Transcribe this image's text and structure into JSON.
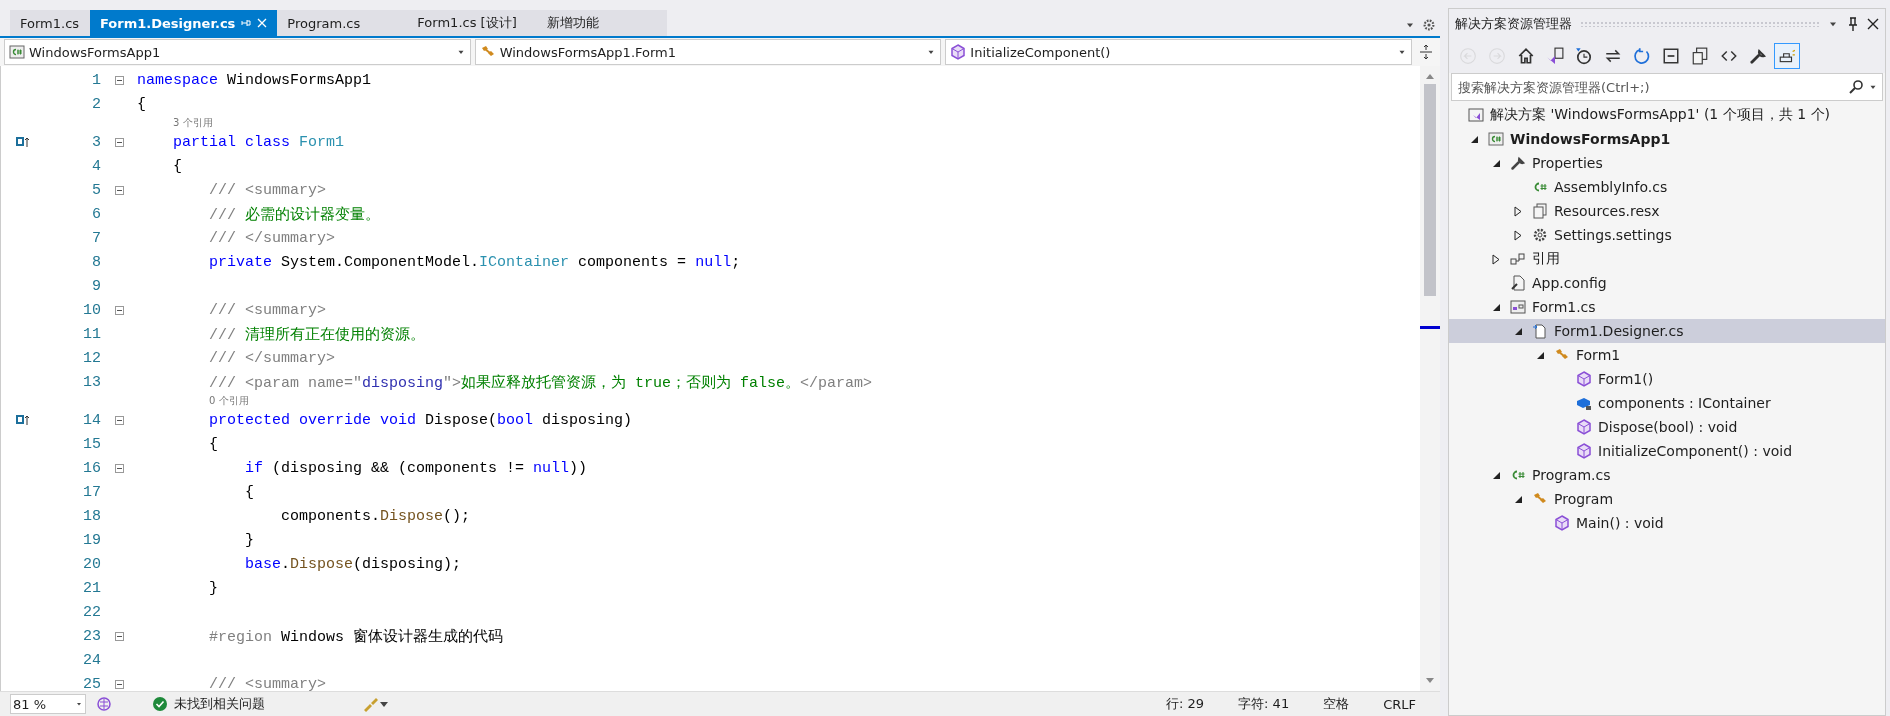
{
  "editor": {
    "tabs": [
      {
        "label": "Form1.cs",
        "selected": false
      },
      {
        "label": "Form1.Designer.cs",
        "selected": true
      },
      {
        "label": "Program.cs",
        "selected": false
      },
      {
        "label": "Form1.cs [设计]",
        "selected": false
      },
      {
        "label": "新增功能",
        "selected": false
      }
    ],
    "nav_bar": [
      {
        "kind": "project",
        "text": "WindowsFormsApp1"
      },
      {
        "kind": "class",
        "text": "WindowsFormsApp1.Form1"
      },
      {
        "kind": "method",
        "text": "InitializeComponent()"
      }
    ],
    "lines": [
      {
        "number": "1",
        "fold_marker": true,
        "margin_glyph": false,
        "tokens": [
          {
            "kind": "keyword",
            "text": "namespace"
          },
          {
            "kind": "plain",
            "text": " WindowsFormsApp1"
          }
        ]
      },
      {
        "number": "2",
        "fold_marker": false,
        "margin_glyph": false,
        "tokens": [
          {
            "kind": "plain",
            "text": "{"
          }
        ]
      },
      {
        "number": "3",
        "fold_marker": true,
        "margin_glyph": true,
        "codelens": "3 个引用",
        "tokens": [
          {
            "kind": "keyword",
            "text": "    partial class "
          },
          {
            "kind": "type",
            "text": "Form1"
          }
        ]
      },
      {
        "number": "4",
        "fold_marker": false,
        "margin_glyph": false,
        "tokens": [
          {
            "kind": "plain",
            "text": "    {"
          }
        ]
      },
      {
        "number": "5",
        "fold_marker": true,
        "margin_glyph": false,
        "tokens": [
          {
            "kind": "doc",
            "text": "        /// <summary>"
          }
        ]
      },
      {
        "number": "6",
        "fold_marker": false,
        "margin_glyph": false,
        "tokens": [
          {
            "kind": "doc",
            "text": "        ///"
          },
          {
            "kind": "comment",
            "text": " 必需的设计器变量。"
          }
        ]
      },
      {
        "number": "7",
        "fold_marker": false,
        "margin_glyph": false,
        "tokens": [
          {
            "kind": "doc",
            "text": "        /// </summary>"
          }
        ]
      },
      {
        "number": "8",
        "fold_marker": false,
        "margin_glyph": false,
        "tokens": [
          {
            "kind": "keyword",
            "text": "        private"
          },
          {
            "kind": "plain",
            "text": " System.ComponentModel."
          },
          {
            "kind": "type",
            "text": "IContainer"
          },
          {
            "kind": "plain",
            "text": " components = "
          },
          {
            "kind": "keyword",
            "text": "null"
          },
          {
            "kind": "plain",
            "text": ";"
          }
        ]
      },
      {
        "number": "9",
        "fold_marker": false,
        "margin_glyph": false
      },
      {
        "number": "10",
        "fold_marker": true,
        "margin_glyph": false,
        "tokens": [
          {
            "kind": "doc",
            "text": "        /// <summary>"
          }
        ]
      },
      {
        "number": "11",
        "fold_marker": false,
        "margin_glyph": false,
        "tokens": [
          {
            "kind": "doc",
            "text": "        ///"
          },
          {
            "kind": "comment",
            "text": " 清理所有正在使用的资源。"
          }
        ]
      },
      {
        "number": "12",
        "fold_marker": false,
        "margin_glyph": false,
        "tokens": [
          {
            "kind": "doc",
            "text": "        /// </summary>"
          }
        ]
      },
      {
        "number": "13",
        "fold_marker": false,
        "margin_glyph": false,
        "tokens": [
          {
            "kind": "doc",
            "text": "        /// <param name=\""
          },
          {
            "kind": "attr",
            "text": "disposing"
          },
          {
            "kind": "doc",
            "text": "\">"
          },
          {
            "kind": "comment",
            "text": "如果应释放托管资源，为 true；否则为 false。"
          },
          {
            "kind": "doc",
            "text": "</param>"
          }
        ]
      },
      {
        "number": "14",
        "fold_marker": true,
        "margin_glyph": true,
        "codelens": "0 个引用",
        "tokens": [
          {
            "kind": "keyword",
            "text": "        protected override void"
          },
          {
            "kind": "plain",
            "text": " Dispose("
          },
          {
            "kind": "keyword",
            "text": "bool"
          },
          {
            "kind": "plain",
            "text": " disposing)"
          }
        ]
      },
      {
        "number": "15",
        "fold_marker": false,
        "margin_glyph": false,
        "tokens": [
          {
            "kind": "plain",
            "text": "        {"
          }
        ]
      },
      {
        "number": "16",
        "fold_marker": true,
        "margin_glyph": false,
        "tokens": [
          {
            "kind": "keyword",
            "text": "            if"
          },
          {
            "kind": "plain",
            "text": " (disposing && (components != "
          },
          {
            "kind": "keyword",
            "text": "null"
          },
          {
            "kind": "plain",
            "text": "))"
          }
        ]
      },
      {
        "number": "17",
        "fold_marker": false,
        "margin_glyph": false,
        "tokens": [
          {
            "kind": "plain",
            "text": "            {"
          }
        ]
      },
      {
        "number": "18",
        "fold_marker": false,
        "margin_glyph": false,
        "tokens": [
          {
            "kind": "plain",
            "text": "                components."
          },
          {
            "kind": "method",
            "text": "Dispose"
          },
          {
            "kind": "plain",
            "text": "();"
          }
        ]
      },
      {
        "number": "19",
        "fold_marker": false,
        "margin_glyph": false,
        "tokens": [
          {
            "kind": "plain",
            "text": "            }"
          }
        ]
      },
      {
        "number": "20",
        "fold_marker": false,
        "margin_glyph": false,
        "tokens": [
          {
            "kind": "keyword",
            "text": "            base"
          },
          {
            "kind": "plain",
            "text": "."
          },
          {
            "kind": "method",
            "text": "Dispose"
          },
          {
            "kind": "plain",
            "text": "(disposing);"
          }
        ]
      },
      {
        "number": "21",
        "fold_marker": false,
        "margin_glyph": false,
        "tokens": [
          {
            "kind": "plain",
            "text": "        }"
          }
        ]
      },
      {
        "number": "22",
        "fold_marker": false,
        "margin_glyph": false
      },
      {
        "number": "23",
        "fold_marker": true,
        "margin_glyph": false,
        "tokens": [
          {
            "kind": "doc",
            "text": "        #region"
          },
          {
            "kind": "plain",
            "text": " Windows 窗体设计器生成的代码"
          }
        ]
      },
      {
        "number": "24",
        "fold_marker": false,
        "margin_glyph": false
      },
      {
        "number": "25",
        "fold_marker": true,
        "margin_glyph": false,
        "tokens": [
          {
            "kind": "doc",
            "text": "        /// <summary>"
          }
        ]
      }
    ],
    "status_bar": {
      "zoom": "81 %",
      "issues": "未找到相关问题",
      "right": [
        "行: 29",
        "字符: 41",
        "空格",
        "CRLF"
      ]
    }
  },
  "solution_explorer": {
    "title": "解决方案资源管理器",
    "toolbar": [
      {
        "kind": "back",
        "disabled": true,
        "on": false
      },
      {
        "kind": "forward",
        "disabled": true,
        "on": false
      },
      {
        "kind": "home",
        "disabled": false,
        "on": false
      },
      {
        "kind": "switch",
        "disabled": false,
        "on": false
      },
      {
        "kind": "history",
        "disabled": false,
        "on": false
      },
      {
        "kind": "sync",
        "disabled": false,
        "on": false
      },
      {
        "kind": "refresh",
        "disabled": false,
        "on": false
      },
      {
        "kind": "collapse",
        "disabled": false,
        "on": false
      },
      {
        "kind": "copy",
        "disabled": false,
        "on": false
      },
      {
        "kind": "code",
        "disabled": false,
        "on": false
      },
      {
        "kind": "properties",
        "disabled": false,
        "on": false
      },
      {
        "kind": "preview",
        "disabled": false,
        "on": true
      }
    ],
    "search": {
      "placeholder": "搜索解决方案资源管理器(Ctrl+;)"
    },
    "tree": [
      {
        "label": "解决方案 'WindowsFormsApp1' (1 个项目，共 1 个)",
        "kind": "solution",
        "selected": false,
        "children": [
          {
            "label": "WindowsFormsApp1",
            "kind": "project",
            "selected": false,
            "expanded": true,
            "children": [
              {
                "label": "Properties",
                "kind": "wrench",
                "selected": false,
                "expanded": true,
                "children": [
                  {
                    "label": "AssemblyInfo.cs",
                    "kind": "csharp",
                    "selected": false
                  },
                  {
                    "label": "Resources.resx",
                    "kind": "resx",
                    "selected": false,
                    "expanded": false
                  },
                  {
                    "label": "Settings.settings",
                    "kind": "settings",
                    "selected": false,
                    "expanded": false
                  }
                ]
              },
              {
                "label": "引用",
                "kind": "references",
                "selected": false,
                "expanded": false
              },
              {
                "label": "App.config",
                "kind": "config",
                "selected": false
              },
              {
                "label": "Form1.cs",
                "kind": "form",
                "selected": false,
                "expanded": true,
                "children": [
                  {
                    "label": "Form1.Designer.cs",
                    "kind": "designer",
                    "selected": true,
                    "expanded": true,
                    "children": [
                      {
                        "label": "Form1",
                        "kind": "class",
                        "selected": false,
                        "expanded": true,
                        "children": [
                          {
                            "label": "Form1()",
                            "kind": "method",
                            "selected": false
                          },
                          {
                            "label": "components : IContainer",
                            "kind": "field",
                            "selected": false
                          },
                          {
                            "label": "Dispose(bool) : void",
                            "kind": "method",
                            "selected": false
                          },
                          {
                            "label": "InitializeComponent() : void",
                            "kind": "method",
                            "selected": false
                          }
                        ]
                      }
                    ]
                  }
                ]
              },
              {
                "label": "Program.cs",
                "kind": "csharp",
                "selected": false,
                "expanded": true,
                "children": [
                  {
                    "label": "Program",
                    "kind": "class",
                    "selected": false,
                    "expanded": true,
                    "children": [
                      {
                        "label": "Main() : void",
                        "kind": "method",
                        "selected": false
                      }
                    ]
                  }
                ]
              }
            ]
          }
        ]
      }
    ]
  }
}
